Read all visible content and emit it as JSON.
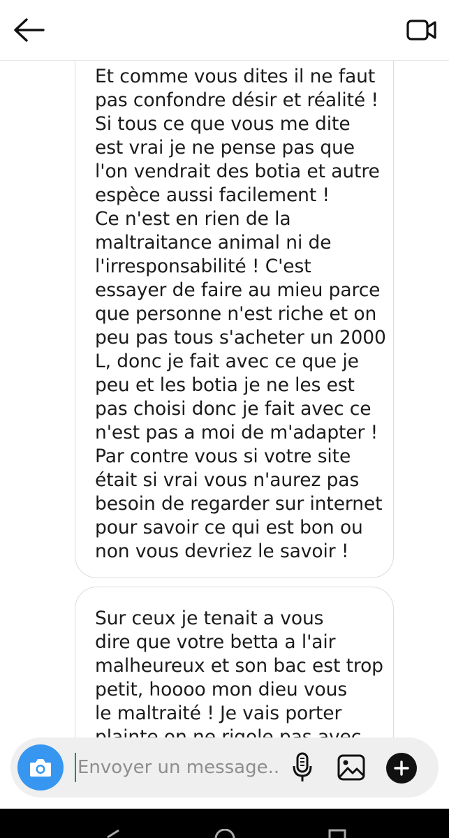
{
  "header": {
    "back_icon": "arrow-left-icon",
    "video_icon": "video-camera-icon"
  },
  "messages": [
    {
      "lines": [
        "Et comme vous dites il ne faut",
        "pas confondre désir et réalité !",
        "Si tous ce que vous me dite",
        "est vrai je ne pense pas que",
        "l'on vendrait des botia et autre",
        "espèce aussi facilement !",
        "Ce n'est en rien de la",
        "maltraitance animal ni de",
        "l'irresponsabilité ! C'est",
        "essayer de faire au mieu parce",
        "que personne n'est riche et on",
        "peu pas tous s'acheter un 2000",
        "L, donc je fait avec ce que je",
        "peu et les botia je ne les est",
        "pas choisi donc je fait avec ce",
        "n'est pas a moi de m'adapter !",
        "Par contre vous si votre site",
        "était si vrai vous n'aurez pas",
        "besoin de regarder sur internet",
        "pour savoir ce qui est bon ou",
        "non vous devriez le savoir !"
      ]
    },
    {
      "lines": [
        "Sur ceux je tenait a vous",
        "dire que votre betta a l'air",
        "malheureux et son bac est trop",
        "petit, hoooo mon dieu vous",
        "le maltraité ! Je vais porter",
        "plainte on ne rigole pas avec"
      ]
    }
  ],
  "composer": {
    "placeholder": "Envoyer un message...",
    "value": "",
    "camera_icon": "camera-icon",
    "mic_icon": "microphone-icon",
    "gallery_icon": "image-gallery-icon",
    "plus_icon": "plus-icon",
    "accent_color": "#3797f0"
  },
  "navbar": {
    "back_icon": "nav-back-icon",
    "home_icon": "nav-home-icon",
    "recents_icon": "nav-recents-icon"
  }
}
